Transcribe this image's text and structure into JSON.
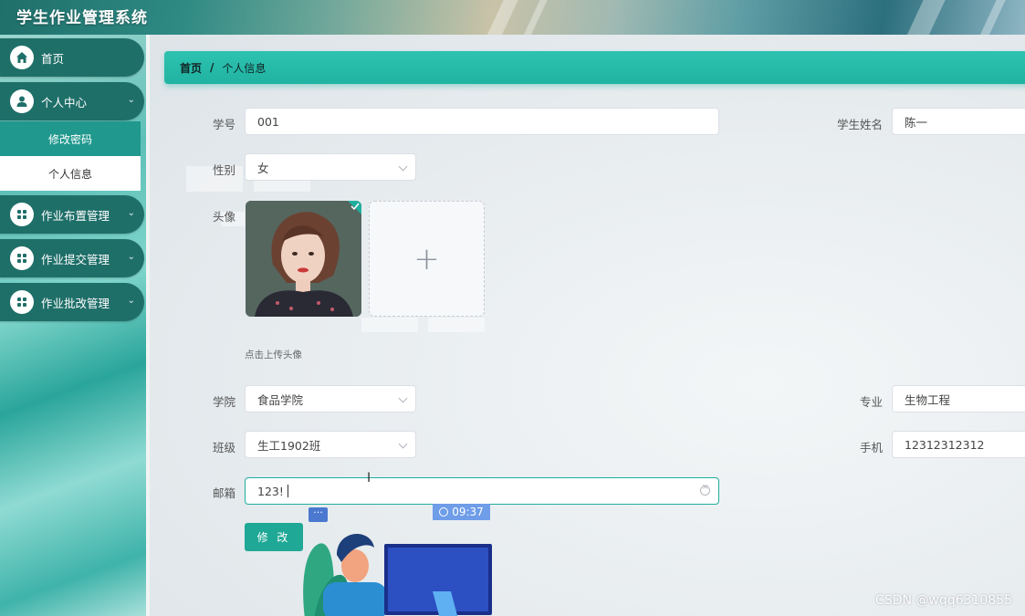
{
  "app": {
    "title": "学生作业管理系统"
  },
  "sidebar": {
    "items": [
      {
        "label": "首页",
        "icon": "home-icon"
      },
      {
        "label": "个人中心",
        "icon": "user-icon"
      },
      {
        "label": "修改密码"
      },
      {
        "label": "个人信息"
      },
      {
        "label": "作业布置管理",
        "icon": "grid-icon"
      },
      {
        "label": "作业提交管理",
        "icon": "grid-icon"
      },
      {
        "label": "作业批改管理",
        "icon": "grid-icon"
      }
    ]
  },
  "breadcrumb": {
    "home": "首页",
    "separator": "/",
    "current": "个人信息"
  },
  "form": {
    "student_no_label": "学号",
    "student_no": "001",
    "student_name_label": "学生姓名",
    "student_name": "陈一",
    "gender_label": "性别",
    "gender": "女",
    "avatar_label": "头像",
    "upload_plus": "+",
    "upload_hint": "点击上传头像",
    "college_label": "学院",
    "college": "食品学院",
    "major_label": "专业",
    "major": "生物工程",
    "class_label": "班级",
    "class": "生工1902班",
    "phone_label": "手机",
    "phone": "12312312312",
    "email_label": "邮箱",
    "email": "123!",
    "submit_label": "修 改"
  },
  "overlay": {
    "clock_time": "09:37",
    "chat_dots": "···"
  },
  "watermark": "CSDN @wqq6310855",
  "colors": {
    "primary": "#1fa896",
    "nav": "#1f6f69",
    "breadcrumb": "#20b3a2"
  }
}
